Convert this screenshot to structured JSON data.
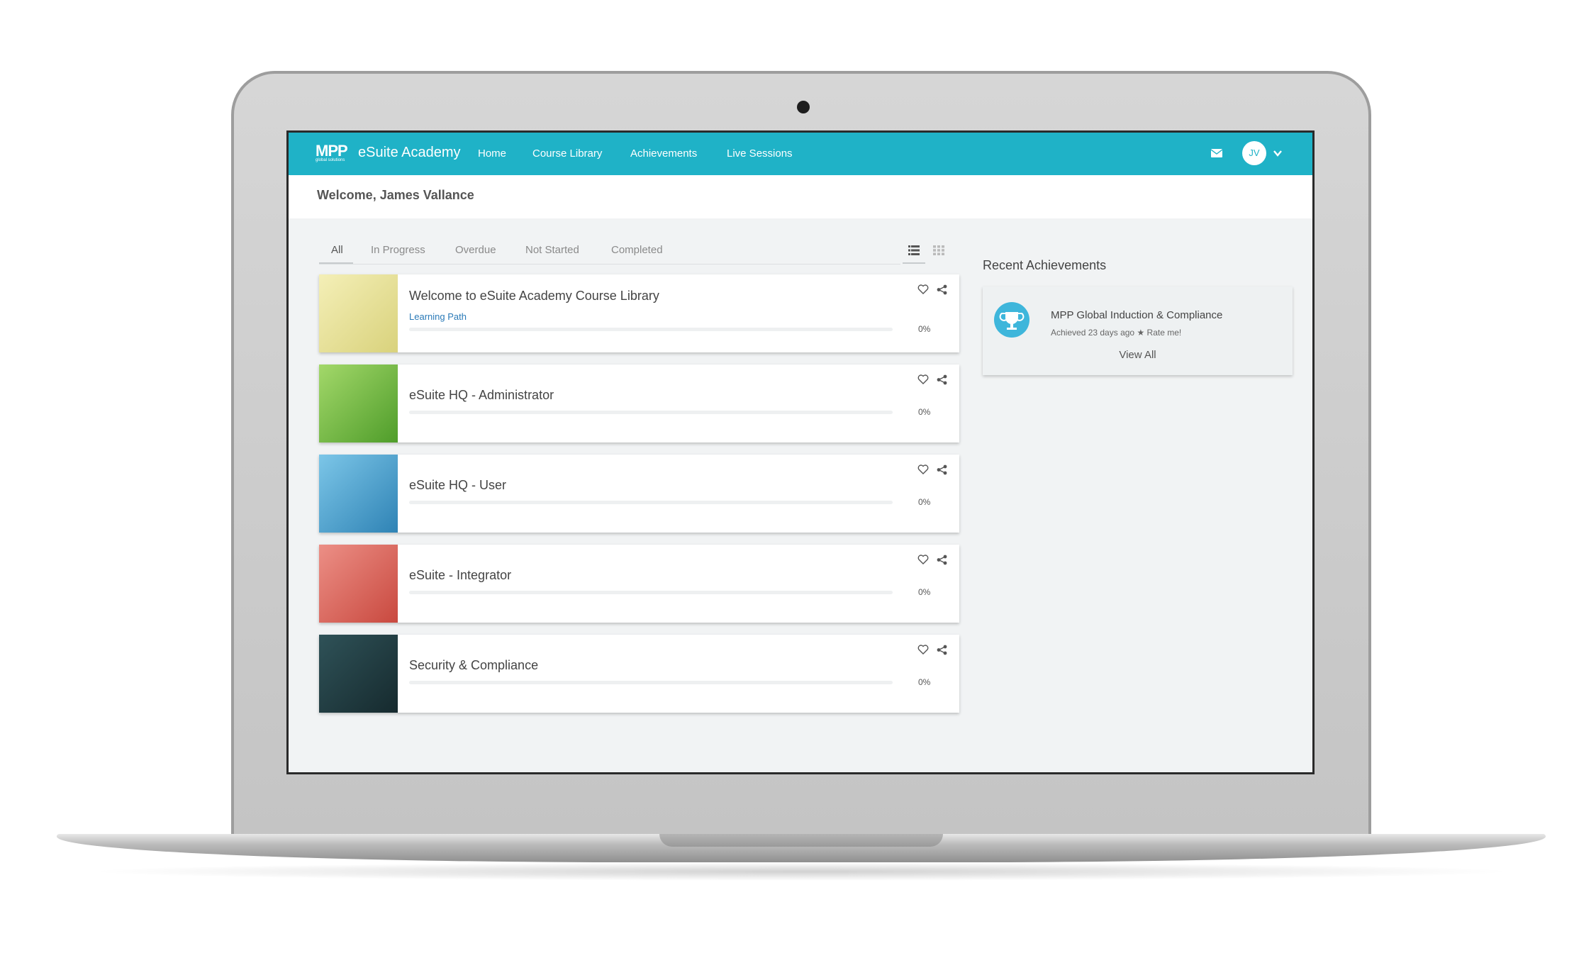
{
  "app": {
    "logo_text": "MPP",
    "logo_subtext": "global solutions",
    "brand": "eSuite Academy"
  },
  "nav": {
    "items": [
      {
        "label": "Home"
      },
      {
        "label": "Course Library"
      },
      {
        "label": "Achievements"
      },
      {
        "label": "Live Sessions"
      }
    ],
    "user_initials": "JV"
  },
  "welcome": "Welcome, James Vallance",
  "tabs": [
    "All",
    "In Progress",
    "Overdue",
    "Not Started",
    "Completed"
  ],
  "active_tab": "All",
  "courses": [
    {
      "title": "Welcome to eSuite Academy Course Library",
      "subtitle": "Learning Path",
      "progress": "0%",
      "progress_value": 0,
      "color": "#e9e39a"
    },
    {
      "title": "eSuite HQ - Administrator",
      "subtitle": "",
      "progress": "0%",
      "progress_value": 0,
      "color": "#7dc63b"
    },
    {
      "title": "eSuite HQ - User",
      "subtitle": "",
      "progress": "0%",
      "progress_value": 0,
      "color": "#3b9fd0"
    },
    {
      "title": "eSuite - Integrator",
      "subtitle": "",
      "progress": "0%",
      "progress_value": 0,
      "color": "#e0675d"
    },
    {
      "title": "Security & Compliance",
      "subtitle": "",
      "progress": "0%",
      "progress_value": 0,
      "color": "#234046"
    }
  ],
  "achievements": {
    "title": "Recent Achievements",
    "items": [
      {
        "name": "MPP Global Induction & Compliance",
        "achieved": "Achieved 23 days ago",
        "rate": "Rate me!"
      }
    ],
    "view_all": "View All"
  },
  "colors": {
    "nav_bg": "#1fb2c7",
    "link": "#2a7ab8",
    "trophy": "#3eb6db"
  },
  "icons": [
    "mail-icon",
    "chevron-down-icon",
    "list-view-icon",
    "grid-view-icon",
    "heart-icon",
    "share-icon",
    "trophy-icon",
    "star-icon"
  ]
}
